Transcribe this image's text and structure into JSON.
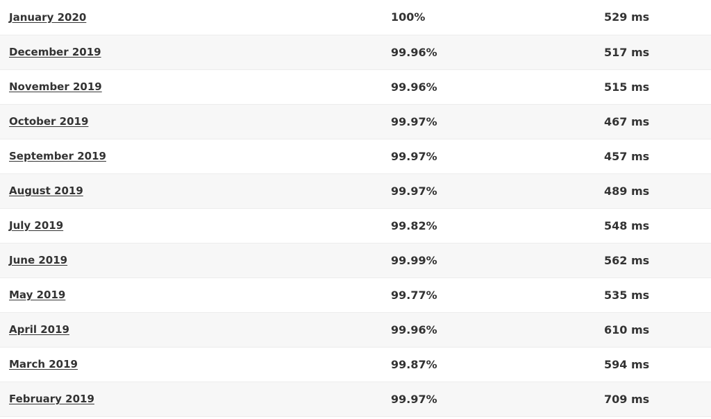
{
  "rows": [
    {
      "month": "January 2020",
      "uptime": "100%",
      "response": "529 ms"
    },
    {
      "month": "December 2019",
      "uptime": "99.96%",
      "response": "517 ms"
    },
    {
      "month": "November 2019",
      "uptime": "99.96%",
      "response": "515 ms"
    },
    {
      "month": "October 2019",
      "uptime": "99.97%",
      "response": "467 ms"
    },
    {
      "month": "September 2019",
      "uptime": "99.97%",
      "response": "457 ms"
    },
    {
      "month": "August 2019",
      "uptime": "99.97%",
      "response": "489 ms"
    },
    {
      "month": "July 2019",
      "uptime": "99.82%",
      "response": "548 ms"
    },
    {
      "month": "June 2019",
      "uptime": "99.99%",
      "response": "562 ms"
    },
    {
      "month": "May 2019",
      "uptime": "99.77%",
      "response": "535 ms"
    },
    {
      "month": "April 2019",
      "uptime": "99.96%",
      "response": "610 ms"
    },
    {
      "month": "March 2019",
      "uptime": "99.87%",
      "response": "594 ms"
    },
    {
      "month": "February 2019",
      "uptime": "99.97%",
      "response": "709 ms"
    }
  ]
}
